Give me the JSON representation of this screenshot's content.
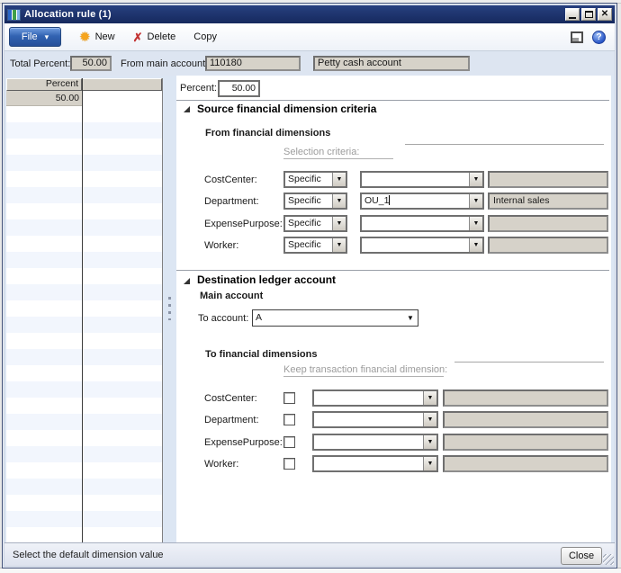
{
  "window": {
    "title": "Allocation rule (1)"
  },
  "toolbar": {
    "file_label": "File",
    "file_arrow": "▾",
    "new_label": "New",
    "delete_label": "Delete",
    "copy_label": "Copy",
    "new_icon_glyph": "✹",
    "delete_icon_glyph": "✗",
    "help_icon_glyph": "?",
    "close_icon_glyph": "✕"
  },
  "header_fields": {
    "total_percent_label": "Total Percent:",
    "total_percent_value": "50.00",
    "from_main_account_label": "From main account:",
    "from_main_account_value": "110180",
    "account_name_value": "Petty cash account"
  },
  "grid": {
    "columns": [
      "Percent",
      ""
    ],
    "selected_row": {
      "percent": "50.00"
    }
  },
  "panel": {
    "percent_label": "Percent:",
    "percent_value": "50.00",
    "source": {
      "title": "Source financial dimension criteria",
      "subtitle": "From financial dimensions",
      "selection_criteria_label": "Selection criteria:",
      "dropdown_glyph": "▼",
      "rows": [
        {
          "label": "CostCenter:",
          "mode": "Specific",
          "value": "",
          "display": ""
        },
        {
          "label": "Department:",
          "mode": "Specific",
          "value": "OU_1",
          "display": "Internal sales"
        },
        {
          "label": "ExpensePurpose:",
          "mode": "Specific",
          "value": "",
          "display": ""
        },
        {
          "label": "Worker:",
          "mode": "Specific",
          "value": "",
          "display": ""
        }
      ]
    },
    "destination": {
      "title": "Destination ledger account",
      "main_account_label": "Main account",
      "to_account_label": "To account:",
      "to_account_value": "A",
      "to_financial_dimensions_label": "To financial dimensions",
      "keep_transaction_label": "Keep transaction financial dimension:",
      "rows": [
        {
          "label": "CostCenter:",
          "checked": false
        },
        {
          "label": "Department:",
          "checked": false
        },
        {
          "label": "ExpensePurpose:",
          "checked": false
        },
        {
          "label": "Worker:",
          "checked": false
        }
      ]
    }
  },
  "statusbar": {
    "message": "Select the default dimension value",
    "close_label": "Close"
  },
  "colors": {
    "titlebar": "#1c3069",
    "accent_blue": "#3263b2",
    "disabled_field": "#d6d2c9",
    "grid_stripe": "#f2f6fd",
    "status_bg": "#e4e9f3"
  }
}
